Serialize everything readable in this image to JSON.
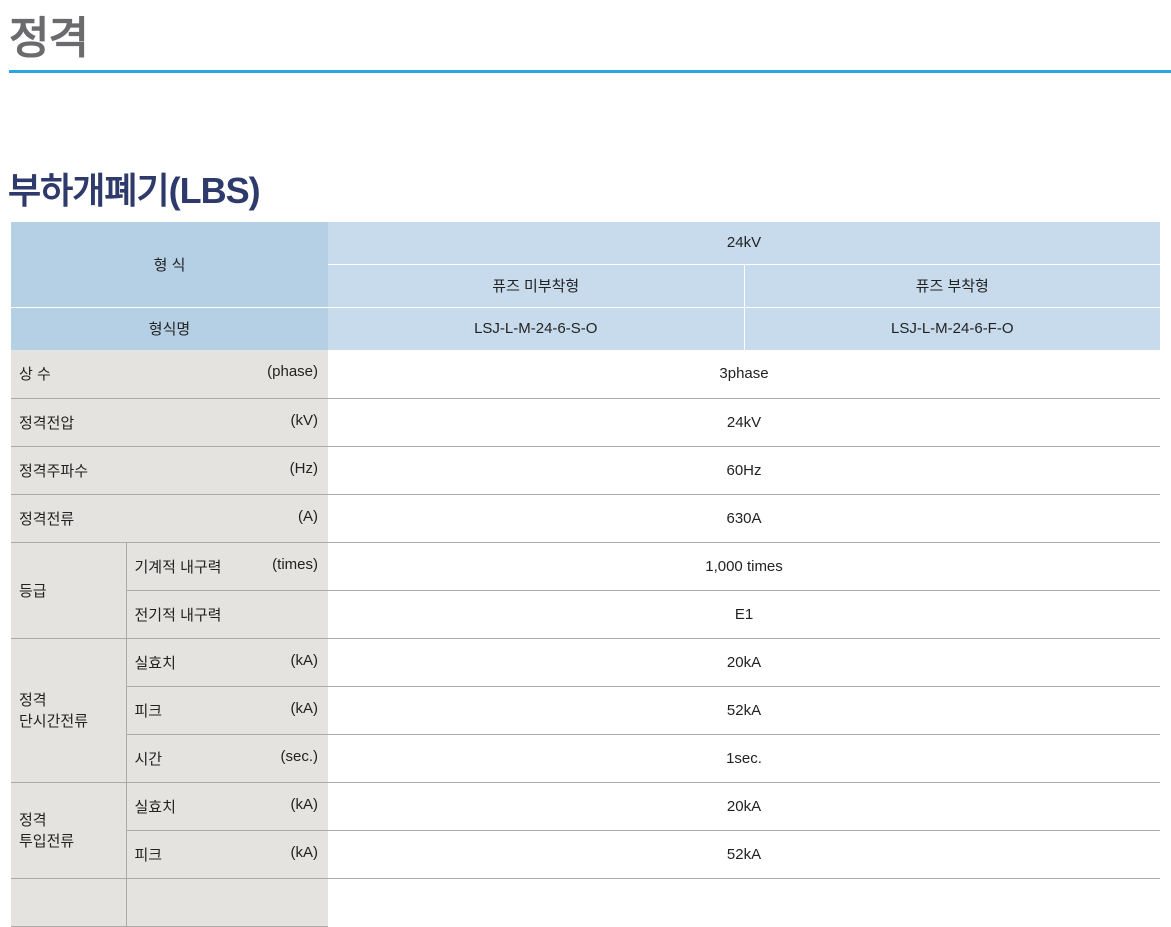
{
  "page_title": "정격",
  "section_title": "부하개폐기(LBS)",
  "table": {
    "header": {
      "type_label": "형 식",
      "voltage": "24kV",
      "col1": "퓨즈 미부착형",
      "col2": "퓨즈 부착형",
      "model_label": "형식명",
      "model1": "LSJ-L-M-24-6-S-O",
      "model2": "LSJ-L-M-24-6-F-O"
    },
    "rows": [
      {
        "label": "상 수",
        "unit": "(phase)",
        "value": "3phase"
      },
      {
        "label": "정격전압",
        "unit": "(kV)",
        "value": "24kV"
      },
      {
        "label": "정격주파수",
        "unit": "(Hz)",
        "value": "60Hz"
      },
      {
        "label": "정격전류",
        "unit": "(A)",
        "value": "630A"
      }
    ],
    "groups": [
      {
        "label": "등급",
        "items": [
          {
            "label": "기계적 내구력",
            "unit": "(times)",
            "value": "1,000 times"
          },
          {
            "label": "전기적 내구력",
            "unit": "",
            "value": "E1"
          }
        ]
      },
      {
        "label_line1": "정격",
        "label_line2": "단시간전류",
        "items": [
          {
            "label": "실효치",
            "unit": "(kA)",
            "value": "20kA"
          },
          {
            "label": "피크",
            "unit": "(kA)",
            "value": "52kA"
          },
          {
            "label": "시간",
            "unit": "(sec.)",
            "value": "1sec."
          }
        ]
      },
      {
        "label_line1": "정격",
        "label_line2": "투입전류",
        "items": [
          {
            "label": "실효치",
            "unit": "(kA)",
            "value": "20kA"
          },
          {
            "label": "피크",
            "unit": "(kA)",
            "value": "52kA"
          }
        ]
      }
    ]
  }
}
